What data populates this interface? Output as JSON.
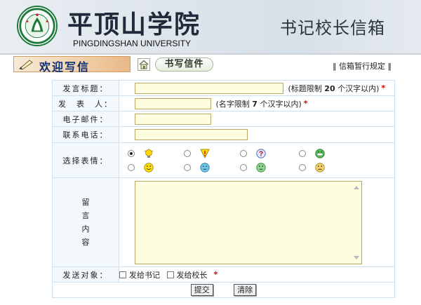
{
  "header": {
    "school_name": "平顶山学院",
    "school_en": "PINGDINGSHAN UNIVERSITY",
    "mailbox_title": "书记校长信箱",
    "logo_icon": "university-seal-icon"
  },
  "toolbar": {
    "welcome_text": "欢迎写信",
    "home_icon": "home-icon",
    "write_label": "书写信件",
    "rules_link": "‖ 信箱暂行规定 ‖"
  },
  "form": {
    "subject": {
      "label": "发言标题：",
      "value": "",
      "note_prefix": "(标题限制",
      "note_count": "20",
      "note_suffix": "个汉字以内)",
      "required": "*"
    },
    "author": {
      "label": "发　表　人：",
      "value": "",
      "note_prefix": "(名字限制",
      "note_count": "7",
      "note_suffix": "个汉字以内)",
      "required": "*"
    },
    "email": {
      "label": "电子邮件：",
      "value": ""
    },
    "phone": {
      "label": "联系电话：",
      "value": ""
    },
    "emotion": {
      "label": "选择表情：",
      "selected_index": 0,
      "options": [
        {
          "icon": "lightbulb-icon"
        },
        {
          "icon": "exclamation-icon"
        },
        {
          "icon": "question-icon"
        },
        {
          "icon": "grin-icon"
        },
        {
          "icon": "smile-icon"
        },
        {
          "icon": "sleepy-icon"
        },
        {
          "icon": "calm-icon"
        },
        {
          "icon": "sad-icon"
        }
      ]
    },
    "message": {
      "label_chars": [
        "留",
        "言",
        "内",
        "容"
      ],
      "value": ""
    },
    "recipient": {
      "label": "发送对象：",
      "options": [
        {
          "label": "发给书记",
          "checked": false
        },
        {
          "label": "发给校长",
          "checked": false
        }
      ],
      "required": "*"
    },
    "submit_label": "提交",
    "reset_label": "清除"
  },
  "colors": {
    "label_bg": "#f3f8fc",
    "border": "#cfe0ee",
    "input_bg": "#fffde0",
    "input_border": "#b9a763",
    "required": "#dd0000",
    "welcome_text": "#0e2f78"
  }
}
